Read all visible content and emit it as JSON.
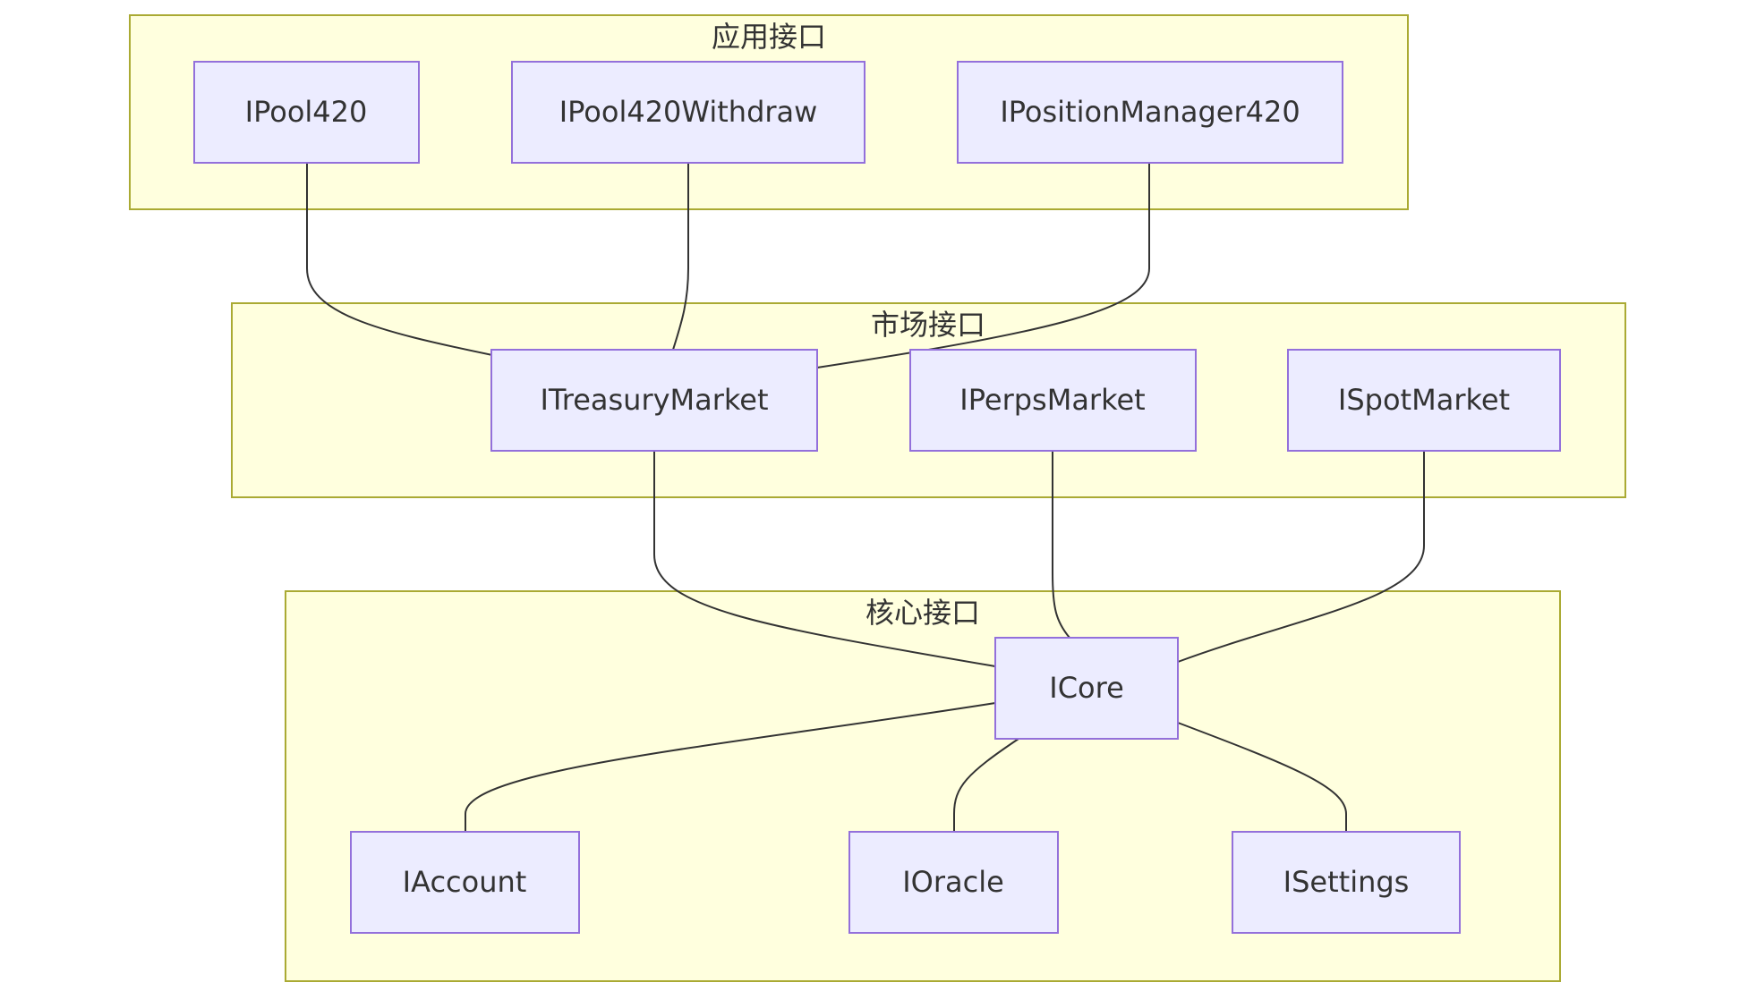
{
  "clusters": {
    "app": {
      "label": "应用接口"
    },
    "market": {
      "label": "市场接口"
    },
    "core": {
      "label": "核心接口"
    }
  },
  "nodes": {
    "ipool420": {
      "label": "IPool420"
    },
    "ipool420withdraw": {
      "label": "IPool420Withdraw"
    },
    "ipositionmanager420": {
      "label": "IPositionManager420"
    },
    "itreasurymarket": {
      "label": "ITreasuryMarket"
    },
    "iperpsmarket": {
      "label": "IPerpsMarket"
    },
    "ispotmarket": {
      "label": "ISpotMarket"
    },
    "icore": {
      "label": "ICore"
    },
    "iaccount": {
      "label": "IAccount"
    },
    "ioracle": {
      "label": "IOracle"
    },
    "isettings": {
      "label": "ISettings"
    }
  },
  "edges": [
    {
      "from": "ipool420",
      "to": "itreasurymarket"
    },
    {
      "from": "ipool420withdraw",
      "to": "itreasurymarket"
    },
    {
      "from": "ipositionmanager420",
      "to": "itreasurymarket"
    },
    {
      "from": "itreasurymarket",
      "to": "icore"
    },
    {
      "from": "iperpsmarket",
      "to": "icore"
    },
    {
      "from": "ispotmarket",
      "to": "icore"
    },
    {
      "from": "icore",
      "to": "iaccount"
    },
    {
      "from": "icore",
      "to": "ioracle"
    },
    {
      "from": "icore",
      "to": "isettings"
    }
  ]
}
